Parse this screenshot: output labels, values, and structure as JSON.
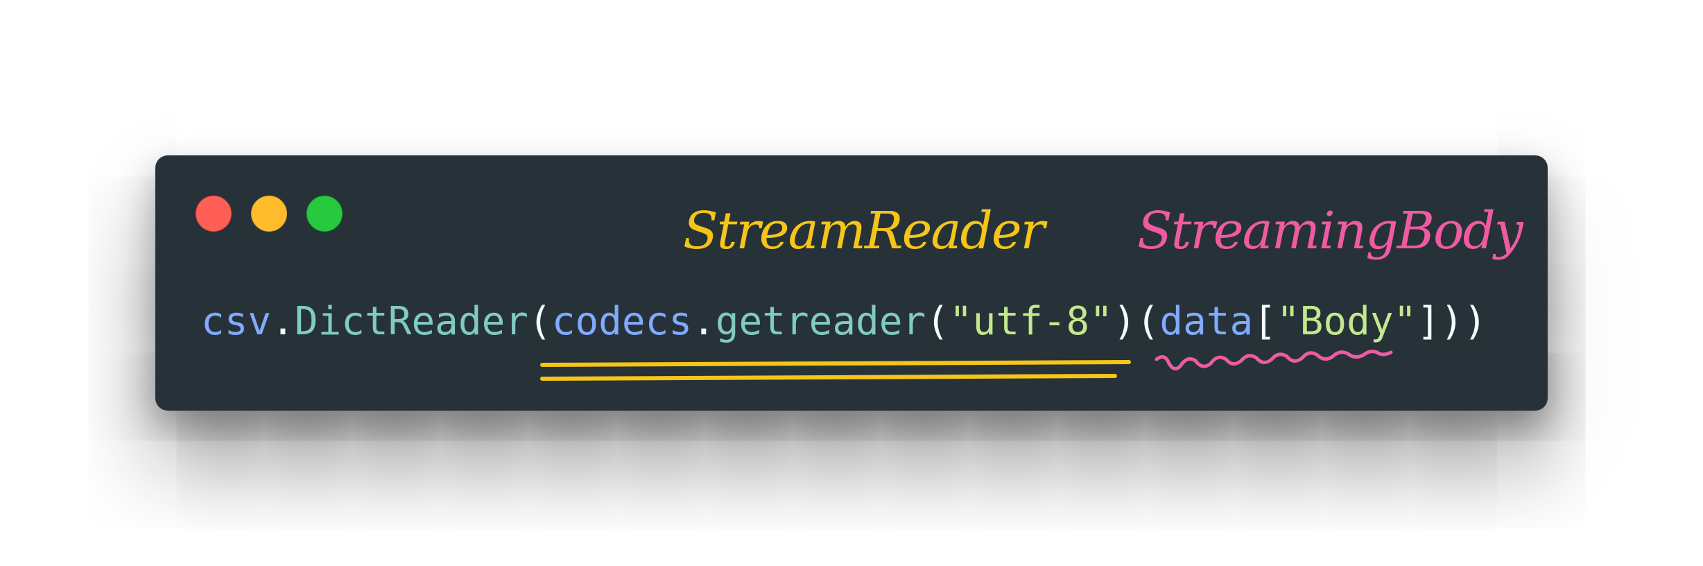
{
  "window": {
    "controls": {
      "close_icon": "red-dot",
      "minimize_icon": "yellow-dot",
      "maximize_icon": "green-dot"
    }
  },
  "code": {
    "tokens": [
      {
        "text": "csv",
        "kind": "var"
      },
      {
        "text": ".",
        "kind": "punc"
      },
      {
        "text": "DictReader",
        "kind": "method"
      },
      {
        "text": "(",
        "kind": "punc"
      },
      {
        "text": "codecs",
        "kind": "var"
      },
      {
        "text": ".",
        "kind": "punc"
      },
      {
        "text": "getreader",
        "kind": "method"
      },
      {
        "text": "(",
        "kind": "punc"
      },
      {
        "text": "\"utf-8\"",
        "kind": "str"
      },
      {
        "text": ")(",
        "kind": "punc"
      },
      {
        "text": "data",
        "kind": "var"
      },
      {
        "text": "[",
        "kind": "punc"
      },
      {
        "text": "\"Body\"",
        "kind": "str"
      },
      {
        "text": "]))",
        "kind": "punc"
      }
    ]
  },
  "annotations": {
    "stream_reader": {
      "label": "StreamReader",
      "color": "#f5c518"
    },
    "streaming_body": {
      "label": "StreamingBody",
      "color": "#ef5ba1"
    }
  },
  "colors": {
    "background": "#263238",
    "var": "#82aaff",
    "method": "#80cbc4",
    "string": "#c3e88d",
    "punctuation": "#eeffff"
  }
}
